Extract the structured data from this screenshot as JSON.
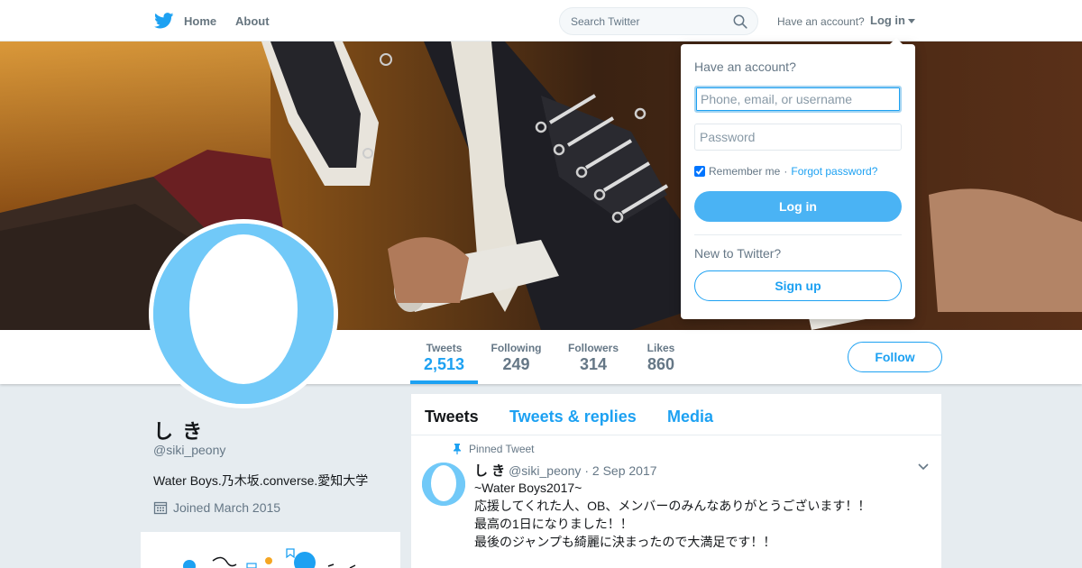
{
  "nav": {
    "home_label": "Home",
    "about_label": "About",
    "search_placeholder": "Search Twitter",
    "have_account": "Have an account?",
    "login_label": "Log in"
  },
  "profile": {
    "display_name": "し き",
    "handle": "@siki_peony",
    "bio": "Water Boys.乃木坂.converse.愛知大学",
    "joined": "Joined March 2015",
    "follow_label": "Follow"
  },
  "stats": [
    {
      "label": "Tweets",
      "value": "2,513"
    },
    {
      "label": "Following",
      "value": "249"
    },
    {
      "label": "Followers",
      "value": "314"
    },
    {
      "label": "Likes",
      "value": "860"
    }
  ],
  "timeline": {
    "tabs": [
      "Tweets",
      "Tweets & replies",
      "Media"
    ],
    "pinned_label": "Pinned Tweet",
    "tweet": {
      "name": "し き",
      "handle": "@siki_peony",
      "separator": "·",
      "date": "2 Sep 2017",
      "lines": [
        "~Water Boys2017~",
        "応援してくれた人、OB、メンバーのみんなありがとうございます！！",
        "最高の1日になりました！！",
        "最後のジャンプも綺麗に決まったので大満足です！！"
      ]
    }
  },
  "login_dropdown": {
    "title": "Have an account?",
    "username_placeholder": "Phone, email, or username",
    "password_placeholder": "Password",
    "remember_label": "Remember me",
    "separator": "·",
    "forgot_label": "Forgot password?",
    "login_button": "Log in",
    "new_label": "New to Twitter?",
    "signup_button": "Sign up"
  },
  "colors": {
    "accent": "#1da1f2",
    "avatar_bg": "#71c9f8",
    "login_button": "#4ab3f4"
  }
}
